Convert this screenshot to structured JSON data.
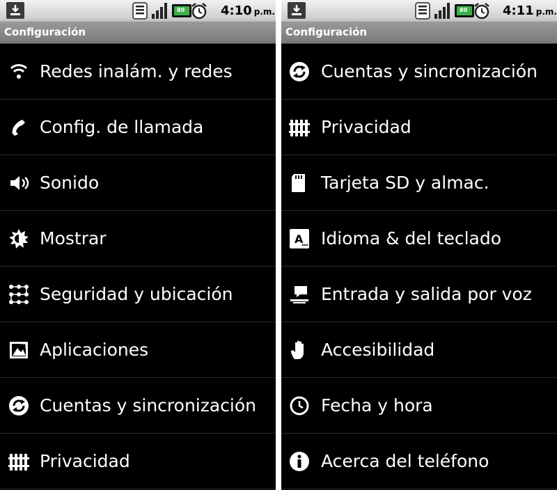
{
  "left": {
    "status_bar": {
      "time": "4:10",
      "ampm": "p.m.",
      "battery_level": "80",
      "icons": [
        "download-notification-icon",
        "vibrate-icon",
        "signal-icon",
        "battery-icon",
        "alarm-icon"
      ]
    },
    "title": "Configuración",
    "items": [
      {
        "label": "Redes inalám. y redes",
        "icon": "wifi-icon"
      },
      {
        "label": "Config. de llamada",
        "icon": "phone-handset-icon"
      },
      {
        "label": "Sonido",
        "icon": "speaker-icon"
      },
      {
        "label": "Mostrar",
        "icon": "brightness-icon"
      },
      {
        "label": "Seguridad y ubicación",
        "icon": "security-grid-icon"
      },
      {
        "label": "Aplicaciones",
        "icon": "applications-icon"
      },
      {
        "label": "Cuentas y sincronización",
        "icon": "sync-icon"
      },
      {
        "label": "Privacidad",
        "icon": "privacy-fence-icon"
      }
    ]
  },
  "right": {
    "status_bar": {
      "time": "4:11",
      "ampm": "p.m.",
      "battery_level": "80",
      "icons": [
        "download-notification-icon",
        "vibrate-icon",
        "signal-icon",
        "battery-icon",
        "alarm-icon"
      ]
    },
    "title": "Configuración",
    "items": [
      {
        "label": "Cuentas y sincronización",
        "icon": "sync-icon"
      },
      {
        "label": "Privacidad",
        "icon": "privacy-fence-icon"
      },
      {
        "label": "Tarjeta SD y almac.",
        "icon": "sd-card-icon"
      },
      {
        "label": "Idioma & del teclado",
        "icon": "keyboard-letter-icon"
      },
      {
        "label": "Entrada y salida por voz",
        "icon": "voice-icon"
      },
      {
        "label": "Accesibilidad",
        "icon": "hand-icon"
      },
      {
        "label": "Fecha y hora",
        "icon": "clock-icon"
      },
      {
        "label": "Acerca del teléfono",
        "icon": "info-icon"
      }
    ]
  },
  "colors": {
    "screen_bg": "#000000",
    "divider": "#2c2c2c",
    "text": "#ffffff",
    "battery_green": "#3bb24a"
  }
}
